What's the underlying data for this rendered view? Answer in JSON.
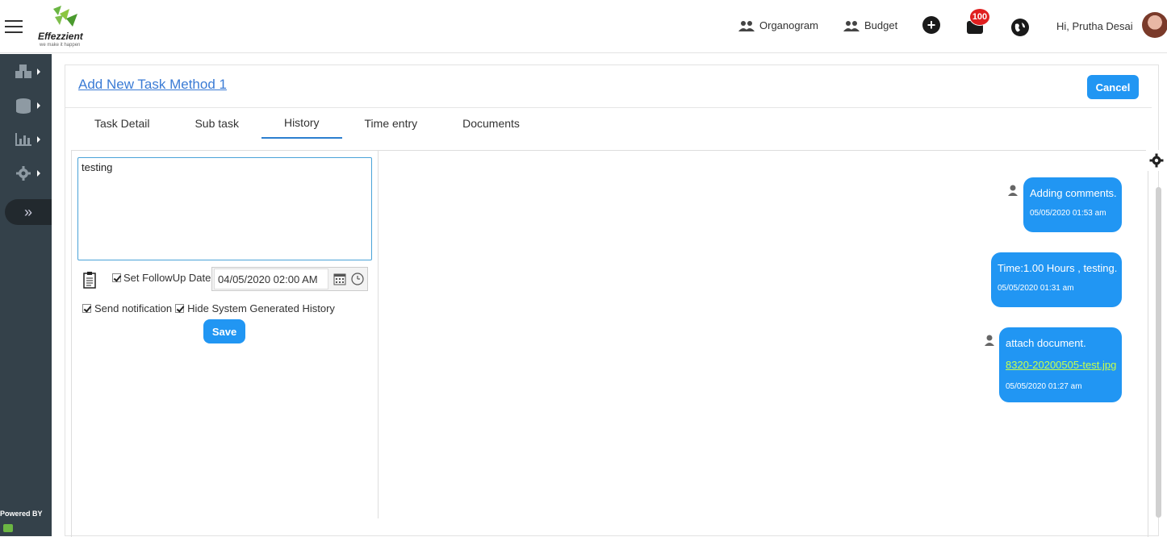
{
  "brand": {
    "name": "Effezzient",
    "tagline": "we make it happen"
  },
  "header": {
    "links": [
      {
        "label": "Organogram"
      },
      {
        "label": "Budget"
      }
    ],
    "notification_count": "100",
    "greeting": "Hi, Prutha Desai"
  },
  "sidebar": {
    "powered_by": "Powered BY"
  },
  "page": {
    "title": "Add New Task Method 1",
    "cancel_label": "Cancel",
    "tabs": [
      {
        "label": "Task Detail"
      },
      {
        "label": "Sub task"
      },
      {
        "label": "History",
        "active": true
      },
      {
        "label": "Time entry"
      },
      {
        "label": "Documents"
      }
    ]
  },
  "history_form": {
    "comment_value": "testing",
    "followup_label": "Set FollowUp Date",
    "followup_checked": true,
    "followup_date": "04/05/2020 02:00 AM",
    "send_notification_label": "Send notification",
    "hide_system_label": "Hide System Generated History",
    "save_label": "Save"
  },
  "history_messages": [
    {
      "text": "Adding comments.",
      "time": "05/05/2020 01:53 am",
      "has_user_icon": true
    },
    {
      "text": "Time:1.00 Hours , testing.",
      "time": "05/05/2020 01:31 am",
      "has_user_icon": false
    },
    {
      "text": "attach document.",
      "link": "8320-20200505-test.jpg",
      "time": "05/05/2020 01:27 am",
      "has_user_icon": true
    }
  ],
  "colors": {
    "accent": "#2196f3",
    "sidebar": "#34414a",
    "link": "#3a7bd5",
    "attachment_link": "#c6ff4a"
  }
}
